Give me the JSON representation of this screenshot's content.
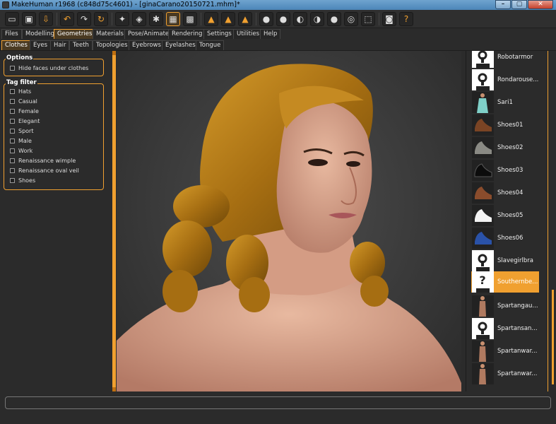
{
  "window": {
    "title": "MakeHuman r1968 (c848d75c4601) - [ginaCarano20150721.mhm]*",
    "controls": [
      "–",
      "▢",
      "✕"
    ]
  },
  "toolbar": {
    "icons": [
      "new-icon",
      "save-icon",
      "export-icon",
      "undo-icon",
      "redo-icon",
      "reset-icon",
      "smooth-icon",
      "wireframe-icon",
      "pose-icon",
      "grid-icon",
      "checker-icon",
      "front-view-icon",
      "back-view-icon",
      "side-view-icon",
      "left-view-icon",
      "right-view-icon",
      "top-view-icon",
      "bottom-view-icon",
      "global-camera-icon",
      "screenshot-icon",
      "help-icon"
    ],
    "help_label": "?"
  },
  "main_tabs": [
    "Files",
    "Modelling",
    "Geometries",
    "Materials",
    "Pose/Animate",
    "Rendering",
    "Settings",
    "Utilities",
    "Help"
  ],
  "main_tab_active": "Geometries",
  "sub_tabs": [
    "Clothes",
    "Eyes",
    "Hair",
    "Teeth",
    "Topologies",
    "Eyebrows",
    "Eyelashes",
    "Tongue"
  ],
  "sub_tab_active": "Clothes",
  "options": {
    "title": "Options",
    "hide_faces_label": "Hide faces under clothes"
  },
  "tag_filter": {
    "title": "Tag filter",
    "tags": [
      "Hats",
      "Casual",
      "Female",
      "Elegant",
      "Sport",
      "Male",
      "Work",
      "Renaissance wimple",
      "Renaissance oval veil",
      "Shoes"
    ]
  },
  "clothes_list": [
    {
      "label": "Robotarmor",
      "thumb": "notfound"
    },
    {
      "label": "Rondarouse...",
      "thumb": "notfound"
    },
    {
      "label": "Sari1",
      "thumb": "sari"
    },
    {
      "label": "Shoes01",
      "thumb": "brown-shoe"
    },
    {
      "label": "Shoes02",
      "thumb": "grey-shoe"
    },
    {
      "label": "Shoes03",
      "thumb": "black-shoe"
    },
    {
      "label": "Shoes04",
      "thumb": "brown-shoe"
    },
    {
      "label": "Shoes05",
      "thumb": "white-shoe"
    },
    {
      "label": "Shoes06",
      "thumb": "blue-shoe"
    },
    {
      "label": "Slavegirlbra",
      "thumb": "notfound"
    },
    {
      "label": "Southernbe...",
      "thumb": "question",
      "selected": true
    },
    {
      "label": "Spartangau...",
      "thumb": "figure"
    },
    {
      "label": "Spartansan...",
      "thumb": "notfound"
    },
    {
      "label": "Spartanwar...",
      "thumb": "figure"
    },
    {
      "label": "Spartanwar...",
      "thumb": "figure"
    }
  ],
  "status": {
    "text": ""
  },
  "colors": {
    "accent": "#f0a030",
    "hair": "#b07a18",
    "skin": "#d9a48c",
    "background": "#2b2b2b"
  }
}
